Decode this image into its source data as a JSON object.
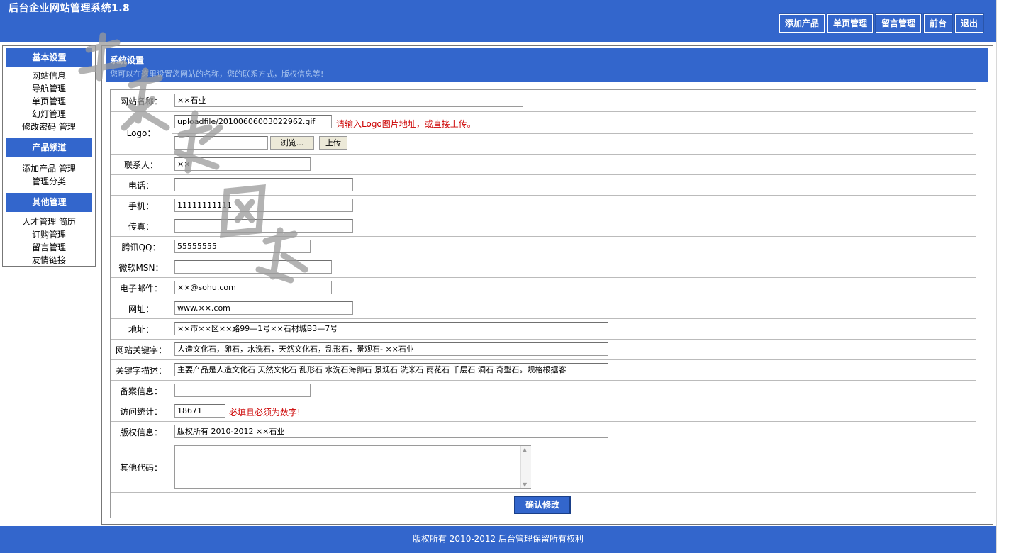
{
  "app": {
    "title": "后台企业网站管理系统1.8"
  },
  "topnav": [
    "添加产品",
    "单页管理",
    "留言管理",
    "前台",
    "退出"
  ],
  "sidebar": {
    "groups": [
      {
        "title": "基本设置",
        "items": [
          "网站信息",
          "导航管理",
          "单页管理",
          "幻灯管理",
          "修改密码 管理"
        ]
      },
      {
        "title": "产品频道",
        "items": [
          "添加产品 管理",
          "管理分类"
        ]
      },
      {
        "title": "其他管理",
        "items": [
          "人才管理 简历",
          "订购管理",
          "留言管理",
          "友情链接"
        ]
      }
    ]
  },
  "main": {
    "title": "系统设置",
    "subtitle": "您可以在这里设置您网站的名称，您的联系方式，版权信息等!"
  },
  "form": {
    "site_name": {
      "label": "网站名称：",
      "value": "××石业"
    },
    "logo": {
      "label": "Logo：",
      "value": "uploadfile/20100606003022962.gif",
      "hint": "请输入Logo图片地址，或直接上传。",
      "browse": "浏览...",
      "upload": "上传"
    },
    "contact": {
      "label": "联系人：",
      "value": "××"
    },
    "phone": {
      "label": "电话：",
      "value": ""
    },
    "mobile": {
      "label": "手机：",
      "value": "11111111111"
    },
    "fax": {
      "label": "传真：",
      "value": ""
    },
    "qq": {
      "label": "腾讯QQ：",
      "value": "55555555"
    },
    "msn": {
      "label": "微软MSN：",
      "value": ""
    },
    "email": {
      "label": "电子邮件：",
      "value": "××@sohu.com"
    },
    "url": {
      "label": "网址：",
      "value": "www.××.com"
    },
    "address": {
      "label": "地址：",
      "value": "××市××区××路99—1号××石材城B3—7号"
    },
    "keywords": {
      "label": "网站关键字：",
      "value": "人造文化石，卵石，水洗石，天然文化石，乱形石，景观石- ××石业"
    },
    "description": {
      "label": "关键字描述：",
      "value": "主要产品是人造文化石 天然文化石 乱形石 水洗石海卵石 景观石 洗米石 雨花石 千层石 洞石 奇型石。规格根据客"
    },
    "icp": {
      "label": "备案信息：",
      "value": ""
    },
    "stats": {
      "label": "访问统计：",
      "value": "18671",
      "hint": "必填且必须为数字!"
    },
    "copyright": {
      "label": "版权信息：",
      "value": "版权所有 2010-2012 ××石业"
    },
    "other_code": {
      "label": "其他代码：",
      "value": ""
    },
    "submit": "确认修改"
  },
  "footer": "版权所有 2010-2012 后台管理保留所有权利",
  "watermark": "天 恩 材 网 络",
  "colors": {
    "brand": "#3366cc",
    "hint": "#cc0000"
  }
}
